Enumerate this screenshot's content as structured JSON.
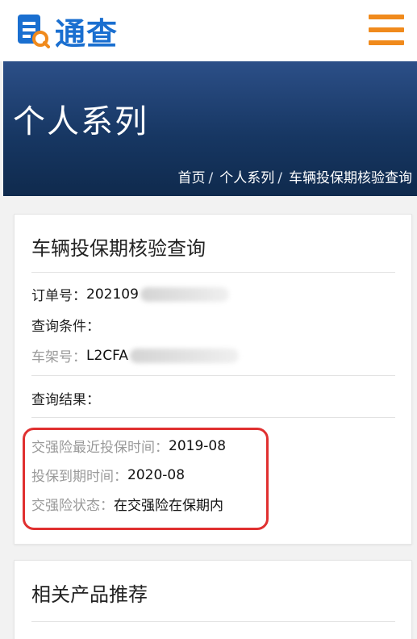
{
  "header": {
    "logo_text": "通查",
    "logo_icon": "document-search-icon",
    "menu_icon": "hamburger-menu-icon",
    "brand_color": "#1a6fd0",
    "menu_color": "#f08a1c"
  },
  "banner": {
    "title": "个人系列",
    "breadcrumb": {
      "home": "首页",
      "category": "个人系列",
      "current": "车辆投保期核验查询",
      "separator": "/"
    }
  },
  "result_card": {
    "title": "车辆投保期核验查询",
    "order_label": "订单号：",
    "order_value": "202109",
    "query_conditions_label": "查询条件：",
    "vin_label": "车架号：",
    "vin_value": "L2CFA",
    "query_result_label": "查询结果：",
    "fields": [
      {
        "label": "交强险最近投保时间：",
        "value": "2019-08"
      },
      {
        "label": "投保到期时间：",
        "value": "2020-08"
      },
      {
        "label": "交强险状态：",
        "value": "在交强险在保期内"
      }
    ],
    "highlight_color": "#e03030"
  },
  "recommend_card": {
    "title": "相关产品推荐"
  }
}
